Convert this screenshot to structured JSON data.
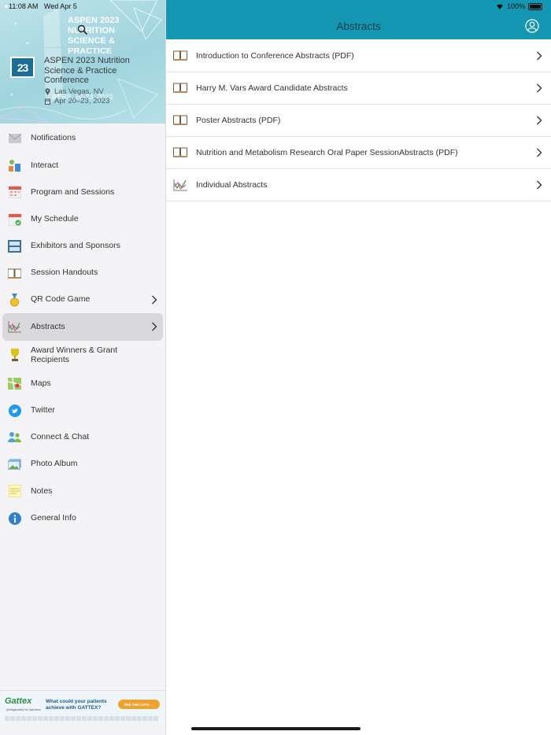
{
  "status_bar": {
    "time": "11:08 AM",
    "date": "Wed Apr 5",
    "battery": "100%"
  },
  "conference": {
    "logo_text": "23",
    "hero_banner_lines": [
      "ASPEN 2023",
      "NUTRITION",
      "SCIENCE &",
      "PRACTICE"
    ],
    "hero_banner_dates": "APRIL 20-23, 2023",
    "title": "ASPEN 2023 Nutrition Science & Practice Conference",
    "location": "Las Vegas, NV",
    "dates": "Apr 20–23, 2023"
  },
  "sidebar": {
    "items": [
      {
        "label": "Notifications",
        "icon": "envelope-icon"
      },
      {
        "label": "Interact",
        "icon": "interact-icon"
      },
      {
        "label": "Program and Sessions",
        "icon": "calendar-icon"
      },
      {
        "label": "My Schedule",
        "icon": "calendar-check-icon"
      },
      {
        "label": "Exhibitors and Sponsors",
        "icon": "exhibitors-icon"
      },
      {
        "label": "Session Handouts",
        "icon": "book-icon"
      },
      {
        "label": "QR Code Game",
        "icon": "medal-icon",
        "chevron": true
      },
      {
        "label": "Abstracts",
        "icon": "chart-icon",
        "chevron": true,
        "active": true
      },
      {
        "label": "Award Winners & Grant Recipients",
        "icon": "trophy-icon"
      },
      {
        "label": "Maps",
        "icon": "map-icon"
      },
      {
        "label": "Twitter",
        "icon": "twitter-icon"
      },
      {
        "label": "Connect & Chat",
        "icon": "people-icon"
      },
      {
        "label": "Photo Album",
        "icon": "photo-icon"
      },
      {
        "label": "Notes",
        "icon": "notes-icon"
      },
      {
        "label": "General Info",
        "icon": "info-icon"
      }
    ]
  },
  "ad": {
    "brand": "Gattex",
    "brand_sub": "(teduglutide) for injection",
    "message": "What could your patients achieve with GATTEX?",
    "cta": "SEE THE DATA"
  },
  "header": {
    "title": "Abstracts"
  },
  "abstracts": [
    {
      "label": "Introduction to Conference Abstracts (PDF)",
      "icon": "book-icon"
    },
    {
      "label": "Harry M. Vars Award Candidate Abstracts",
      "icon": "book-icon"
    },
    {
      "label": "Poster Abstracts (PDF)",
      "icon": "book-icon"
    },
    {
      "label": "Nutrition and Metabolism Research Oral Paper SessionAbstracts (PDF)",
      "icon": "book-icon"
    },
    {
      "label": "Individual Abstracts",
      "icon": "chart-icon"
    }
  ],
  "colors": {
    "header": "#1497b2",
    "active_bg": "#d9d9dc",
    "sidebar_bg": "#f4f4f6"
  }
}
